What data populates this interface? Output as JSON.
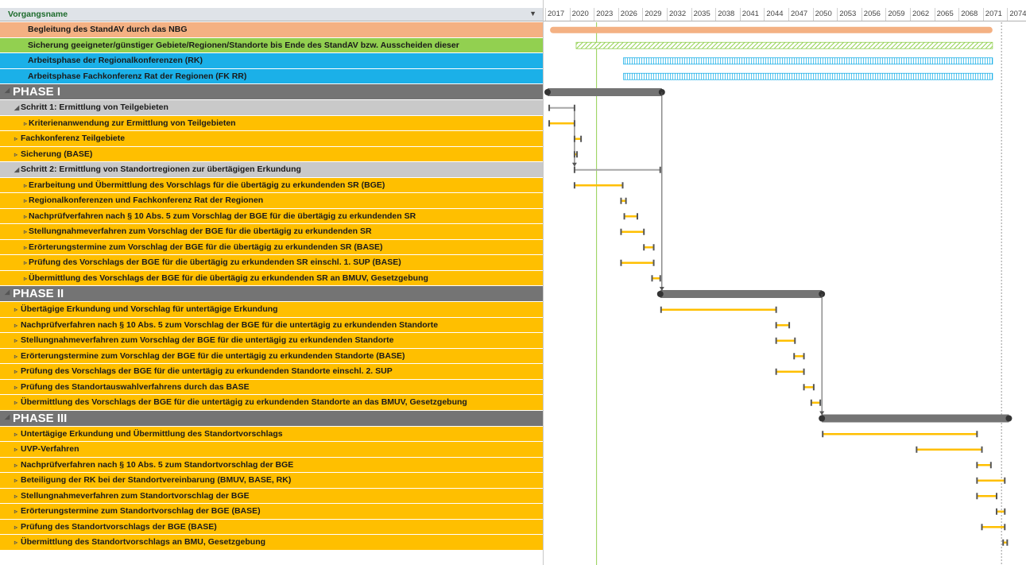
{
  "header": {
    "column_title": "Vorgangsname"
  },
  "timescale": {
    "years": [
      "2017",
      "2020",
      "2023",
      "2026",
      "2029",
      "2032",
      "2035",
      "2038",
      "2041",
      "2044",
      "2047",
      "2050",
      "2053",
      "2056",
      "2059",
      "2062",
      "2065",
      "2068",
      "2071",
      "2074"
    ]
  },
  "rows": [
    {
      "label": "Begleitung des StandAV durch das NBG",
      "style": "salmon",
      "indent": 0,
      "arrow": "",
      "bar": {
        "type": "solid",
        "color": "#f4b183",
        "start": 2017.3,
        "end": 2071.5
      }
    },
    {
      "label": "Sicherung geeigneter/günstiger Gebiete/Regionen/Standorte bis Ende des StandAV bzw. Ausscheiden dieser",
      "style": "green",
      "indent": 0,
      "arrow": "",
      "bar": {
        "type": "hatch",
        "color": "#92d050",
        "start": 2020.5,
        "end": 2071.5
      }
    },
    {
      "label": "Arbeitsphase der Regionalkonferenzen (RK)",
      "style": "blue",
      "indent": 0,
      "arrow": "",
      "bar": {
        "type": "hatch",
        "color": "#1bb0e8",
        "start": 2026.3,
        "end": 2071.5
      }
    },
    {
      "label": "Arbeitsphase Fachkonferenz Rat der Regionen (FK RR)",
      "style": "blue",
      "indent": 0,
      "arrow": "",
      "bar": {
        "type": "hatch",
        "color": "#1bb0e8",
        "start": 2026.3,
        "end": 2071.5
      }
    },
    {
      "label": "PHASE I",
      "style": "phase",
      "indent": 0,
      "arrow": "◢",
      "bar": {
        "type": "summary",
        "start": 2017.0,
        "end": 2031.0
      }
    },
    {
      "label": "Schritt 1: Ermittlung von Teilgebieten",
      "style": "gray",
      "indent": 1,
      "arrow": "◢",
      "bar": {
        "type": "group",
        "start": 2017.2,
        "end": 2020.3
      }
    },
    {
      "label": "Kriterienanwendung zur Ermittlung von Teilgebieten",
      "style": "orange",
      "indent": 2,
      "arrow": "▹",
      "bar": {
        "type": "task",
        "start": 2017.2,
        "end": 2020.3
      }
    },
    {
      "label": "Fachkonferenz Teilgebiete",
      "style": "orange",
      "indent": 1,
      "arrow": "▹",
      "bar": {
        "type": "task",
        "start": 2020.3,
        "end": 2021.1
      }
    },
    {
      "label": "Sicherung  (BASE)",
      "style": "orange",
      "indent": 1,
      "arrow": "▹",
      "bar": {
        "type": "task",
        "start": 2020.3,
        "end": 2020.6
      }
    },
    {
      "label": "Schritt 2: Ermittlung von Standortregionen zur übertägigen Erkundung",
      "style": "gray",
      "indent": 1,
      "arrow": "◢",
      "bar": {
        "type": "group",
        "start": 2020.3,
        "end": 2030.8
      }
    },
    {
      "label": "Erarbeitung und Übermittlung des Vorschlags für die übertägig zu erkundenden SR (BGE)",
      "style": "orange",
      "indent": 2,
      "arrow": "▹",
      "bar": {
        "type": "task",
        "start": 2020.3,
        "end": 2026.2
      }
    },
    {
      "label": "Regionalkonferenzen und Fachkonferenz Rat der Regionen",
      "style": "orange",
      "indent": 2,
      "arrow": "▹",
      "bar": {
        "type": "task",
        "start": 2026.0,
        "end": 2026.6
      }
    },
    {
      "label": "Nachprüfverfahren nach § 10 Abs. 5 zum Vorschlag der BGE für die übertägig zu erkundenden SR",
      "style": "orange",
      "indent": 2,
      "arrow": "▹",
      "bar": {
        "type": "task",
        "start": 2026.4,
        "end": 2028.0
      }
    },
    {
      "label": "Stellungnahmeverfahren zum Vorschlag der BGE für die übertägig zu erkundenden SR",
      "style": "orange",
      "indent": 2,
      "arrow": "▹",
      "bar": {
        "type": "task",
        "start": 2026.0,
        "end": 2028.8
      }
    },
    {
      "label": "Erörterungstermine zum Vorschlag der BGE für die übertägig zu erkundenden SR (BASE)",
      "style": "orange",
      "indent": 2,
      "arrow": "▹",
      "bar": {
        "type": "task",
        "start": 2028.8,
        "end": 2030.0
      }
    },
    {
      "label": "Prüfung des Vorschlags der BGE für die übertägig zu erkundenden SR einschl. 1. SUP (BASE)",
      "style": "orange",
      "indent": 2,
      "arrow": "▹",
      "bar": {
        "type": "task",
        "start": 2026.0,
        "end": 2030.0
      }
    },
    {
      "label": "Übermittlung des Vorschlags der BGE für die übertägig zu erkundenden SR an BMUV, Gesetzgebung",
      "style": "orange",
      "indent": 2,
      "arrow": "▹",
      "bar": {
        "type": "task",
        "start": 2029.8,
        "end": 2030.8
      }
    },
    {
      "label": "PHASE II",
      "style": "phase",
      "indent": 0,
      "arrow": "◢",
      "bar": {
        "type": "summary",
        "start": 2030.8,
        "end": 2050.6
      }
    },
    {
      "label": "Übertägige Erkundung und Vorschlag für untertägige Erkundung",
      "style": "orange",
      "indent": 1,
      "arrow": "▹",
      "bar": {
        "type": "task",
        "start": 2030.9,
        "end": 2045.0
      }
    },
    {
      "label": "Nachprüfverfahren nach § 10 Abs. 5 zum Vorschlag der BGE für die untertägig zu erkundenden Standorte",
      "style": "orange",
      "indent": 1,
      "arrow": "▹",
      "bar": {
        "type": "task",
        "start": 2045.0,
        "end": 2046.6
      }
    },
    {
      "label": "Stellungnahmeverfahren zum Vorschlag der BGE für die untertägig zu erkundenden Standorte",
      "style": "orange",
      "indent": 1,
      "arrow": "▹",
      "bar": {
        "type": "task",
        "start": 2045.0,
        "end": 2047.3
      }
    },
    {
      "label": "Erörterungstermine zum Vorschlag der BGE für die untertägig zu erkundenden Standorte (BASE)",
      "style": "orange",
      "indent": 1,
      "arrow": "▹",
      "bar": {
        "type": "task",
        "start": 2047.2,
        "end": 2048.4
      }
    },
    {
      "label": "Prüfung des Vorschlags der BGE für die untertägig zu erkundenden Standorte einschl. 2. SUP",
      "style": "orange",
      "indent": 1,
      "arrow": "▹",
      "bar": {
        "type": "task",
        "start": 2045.0,
        "end": 2048.4
      }
    },
    {
      "label": "Prüfung des Standortauswahlverfahrens durch das BASE",
      "style": "orange",
      "indent": 1,
      "arrow": "▹",
      "bar": {
        "type": "task",
        "start": 2048.4,
        "end": 2049.6
      }
    },
    {
      "label": "Übermittlung des Vorschlags der BGE für die untertägig zu erkundenden Standorte an das BMUV, Gesetzgebung",
      "style": "orange",
      "indent": 1,
      "arrow": "▹",
      "bar": {
        "type": "task",
        "start": 2049.3,
        "end": 2050.4
      }
    },
    {
      "label": "PHASE III",
      "style": "phase",
      "indent": 0,
      "arrow": "◢",
      "bar": {
        "type": "summary",
        "start": 2050.6,
        "end": 2073.5
      }
    },
    {
      "label": "Untertägige Erkundung und Übermittlung des Standortvorschlags",
      "style": "orange",
      "indent": 1,
      "arrow": "▹",
      "bar": {
        "type": "task",
        "start": 2050.7,
        "end": 2069.6
      }
    },
    {
      "label": "UVP-Verfahren",
      "style": "orange",
      "indent": 1,
      "arrow": "▹",
      "bar": {
        "type": "task",
        "start": 2062.2,
        "end": 2070.2
      }
    },
    {
      "label": "Nachprüfverfahren nach § 10 Abs. 5 zum Standortvorschlag der BGE",
      "style": "orange",
      "indent": 1,
      "arrow": "▹",
      "bar": {
        "type": "task",
        "start": 2069.6,
        "end": 2071.3
      }
    },
    {
      "label": "Beteiligung der RK bei der Standortvereinbarung (BMUV, BASE, RK)",
      "style": "orange",
      "indent": 1,
      "arrow": "▹",
      "bar": {
        "type": "task",
        "start": 2069.6,
        "end": 2073.0
      }
    },
    {
      "label": "Stellungnahmeverfahren zum Standortvorschlag der BGE",
      "style": "orange",
      "indent": 1,
      "arrow": "▹",
      "bar": {
        "type": "task",
        "start": 2069.6,
        "end": 2072.0
      }
    },
    {
      "label": "Erörterungstermine zum Standortvorschlag der BGE (BASE)",
      "style": "orange",
      "indent": 1,
      "arrow": "▹",
      "bar": {
        "type": "task",
        "start": 2072.0,
        "end": 2073.0
      }
    },
    {
      "label": "Prüfung des Standortvorschlags der BGE (BASE)",
      "style": "orange",
      "indent": 1,
      "arrow": "▹",
      "bar": {
        "type": "task",
        "start": 2070.2,
        "end": 2073.0
      }
    },
    {
      "label": "Übermittlung des Standortvorschlags an BMU, Gesetzgebung",
      "style": "orange",
      "indent": 1,
      "arrow": "▹",
      "bar": {
        "type": "task",
        "start": 2072.8,
        "end": 2073.3
      }
    }
  ],
  "markers": {
    "status_date_year": 2023.0,
    "end_line_year": 2072.6
  },
  "colors": {
    "task": "#ffbf00",
    "summary": "#747474",
    "group": "#a6a6a6",
    "status_line": "#92d050"
  }
}
